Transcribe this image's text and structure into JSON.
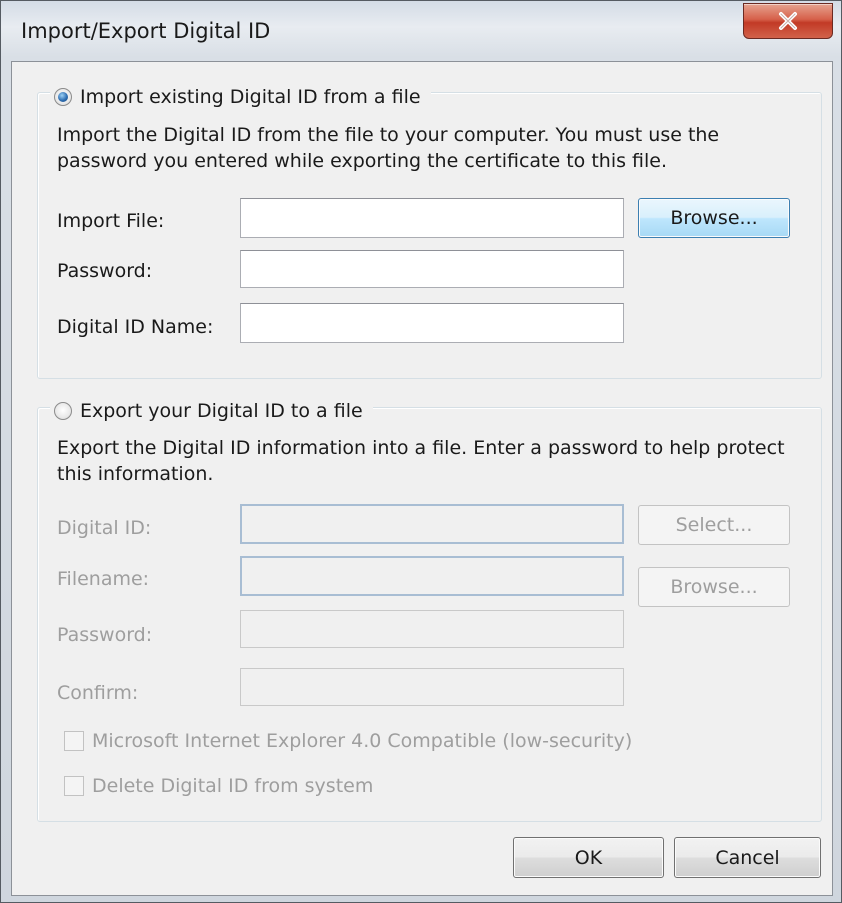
{
  "window": {
    "title": "Import/Export Digital ID",
    "close_label": "X"
  },
  "import_section": {
    "option_label": "Import existing Digital ID from a file",
    "selected": true,
    "description_line1": "Import the Digital ID from the file to your computer. You must use the",
    "description_line2": "password you entered while exporting the certificate to this file.",
    "fields": {
      "import_file_label": "Import File:",
      "import_file_value": "",
      "password_label": "Password:",
      "password_value": "",
      "digital_id_name_label": "Digital ID Name:",
      "digital_id_name_value": ""
    },
    "browse_label": "Browse..."
  },
  "export_section": {
    "option_label": "Export your Digital ID to a file",
    "selected": false,
    "description_line1": "Export the Digital ID information into a file. Enter a password to help protect",
    "description_line2": "this information.",
    "fields": {
      "digital_id_label": "Digital ID:",
      "digital_id_value": "",
      "filename_label": "Filename:",
      "filename_value": "",
      "password_label": "Password:",
      "password_value": "",
      "confirm_label": "Confirm:",
      "confirm_value": ""
    },
    "select_label": "Select...",
    "browse_label": "Browse...",
    "checkboxes": {
      "ie_compatible_label": "Microsoft Internet Explorer 4.0 Compatible (low-security)",
      "ie_compatible_checked": false,
      "delete_label": "Delete Digital ID from system",
      "delete_checked": false
    }
  },
  "footer": {
    "ok_label": "OK",
    "cancel_label": "Cancel"
  }
}
